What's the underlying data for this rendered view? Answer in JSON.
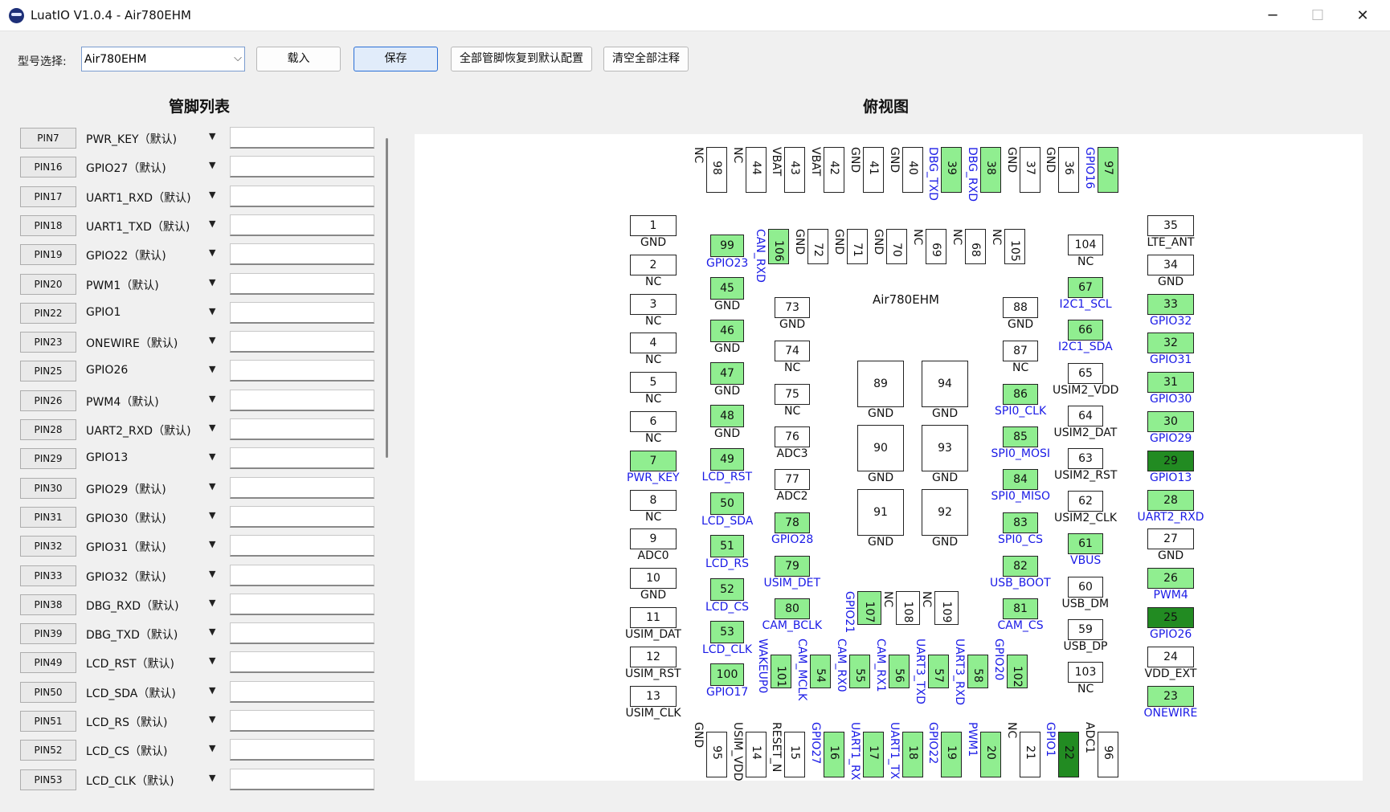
{
  "window": {
    "title": "LuatIO V1.0.4 - Air780EHM",
    "minimize": "─",
    "maximize": "☐",
    "close": "✕"
  },
  "toolbar": {
    "model_label": "型号选择:",
    "model_value": "Air780EHM",
    "load": "载入",
    "save": "保存",
    "restore": "全部管脚恢复到默认配置",
    "clear": "清空全部注释"
  },
  "pin_list": {
    "heading": "管脚列表",
    "items": [
      {
        "pin": "PIN7",
        "func": "PWR_KEY（默认)"
      },
      {
        "pin": "PIN16",
        "func": "GPIO27（默认)"
      },
      {
        "pin": "PIN17",
        "func": "UART1_RXD（默认)"
      },
      {
        "pin": "PIN18",
        "func": "UART1_TXD（默认)"
      },
      {
        "pin": "PIN19",
        "func": "GPIO22（默认)"
      },
      {
        "pin": "PIN20",
        "func": "PWM1（默认)"
      },
      {
        "pin": "PIN22",
        "func": "GPIO1"
      },
      {
        "pin": "PIN23",
        "func": "ONEWIRE（默认)"
      },
      {
        "pin": "PIN25",
        "func": "GPIO26"
      },
      {
        "pin": "PIN26",
        "func": "PWM4（默认)"
      },
      {
        "pin": "PIN28",
        "func": "UART2_RXD（默认)"
      },
      {
        "pin": "PIN29",
        "func": "GPIO13"
      },
      {
        "pin": "PIN30",
        "func": "GPIO29（默认)"
      },
      {
        "pin": "PIN31",
        "func": "GPIO30（默认)"
      },
      {
        "pin": "PIN32",
        "func": "GPIO31（默认)"
      },
      {
        "pin": "PIN33",
        "func": "GPIO32（默认)"
      },
      {
        "pin": "PIN38",
        "func": "DBG_RXD（默认)"
      },
      {
        "pin": "PIN39",
        "func": "DBG_TXD（默认)"
      },
      {
        "pin": "PIN49",
        "func": "LCD_RST（默认)"
      },
      {
        "pin": "PIN50",
        "func": "LCD_SDA（默认)"
      },
      {
        "pin": "PIN51",
        "func": "LCD_RS（默认)"
      },
      {
        "pin": "PIN52",
        "func": "LCD_CS（默认)"
      },
      {
        "pin": "PIN53",
        "func": "LCD_CLK（默认)"
      }
    ]
  },
  "top_view": {
    "heading": "俯视图",
    "chip_name": "Air780EHM",
    "top_pins": [
      {
        "num": "98",
        "label": "NC",
        "state": "n"
      },
      {
        "num": "44",
        "label": "NC",
        "state": "n"
      },
      {
        "num": "43",
        "label": "VBAT",
        "state": "n"
      },
      {
        "num": "42",
        "label": "VBAT",
        "state": "n"
      },
      {
        "num": "41",
        "label": "GND",
        "state": "n"
      },
      {
        "num": "40",
        "label": "GND",
        "state": "n"
      },
      {
        "num": "39",
        "label": "DBG_TXD",
        "state": "g"
      },
      {
        "num": "38",
        "label": "DBG_RXD",
        "state": "g"
      },
      {
        "num": "37",
        "label": "GND",
        "state": "n"
      },
      {
        "num": "36",
        "label": "GND",
        "state": "n"
      },
      {
        "num": "97",
        "label": "GPIO16",
        "state": "g"
      }
    ],
    "left_pins": [
      {
        "num": "1",
        "label": "GND",
        "state": "n"
      },
      {
        "num": "2",
        "label": "NC",
        "state": "n"
      },
      {
        "num": "3",
        "label": "NC",
        "state": "n"
      },
      {
        "num": "4",
        "label": "NC",
        "state": "n"
      },
      {
        "num": "5",
        "label": "NC",
        "state": "n"
      },
      {
        "num": "6",
        "label": "NC",
        "state": "n"
      },
      {
        "num": "7",
        "label": "PWR_KEY",
        "state": "g"
      },
      {
        "num": "8",
        "label": "NC",
        "state": "n"
      },
      {
        "num": "9",
        "label": "ADC0",
        "state": "n"
      },
      {
        "num": "10",
        "label": "GND",
        "state": "n"
      },
      {
        "num": "11",
        "label": "USIM_DAT",
        "state": "n"
      },
      {
        "num": "12",
        "label": "USIM_RST",
        "state": "n"
      },
      {
        "num": "13",
        "label": "USIM_CLK",
        "state": "n"
      }
    ],
    "left_inner": [
      {
        "num": "99",
        "label": "GPIO23",
        "state": "g"
      },
      {
        "num": "45",
        "label": "GND",
        "state": "n"
      },
      {
        "num": "46",
        "label": "GND",
        "state": "n"
      },
      {
        "num": "47",
        "label": "GND",
        "state": "n"
      },
      {
        "num": "48",
        "label": "GND",
        "state": "n"
      },
      {
        "num": "49",
        "label": "LCD_RST",
        "state": "g"
      },
      {
        "num": "50",
        "label": "LCD_SDA",
        "state": "g"
      },
      {
        "num": "51",
        "label": "LCD_RS",
        "state": "g"
      },
      {
        "num": "52",
        "label": "LCD_CS",
        "state": "g"
      },
      {
        "num": "53",
        "label": "LCD_CLK",
        "state": "g"
      },
      {
        "num": "100",
        "label": "GPIO17",
        "state": "g"
      }
    ],
    "second_top": [
      {
        "num": "106",
        "label": "CAN_RXD",
        "state": "g"
      },
      {
        "num": "72",
        "label": "GND",
        "state": "n"
      },
      {
        "num": "71",
        "label": "GND",
        "state": "n"
      },
      {
        "num": "70",
        "label": "GND",
        "state": "n"
      },
      {
        "num": "69",
        "label": "NC",
        "state": "n"
      },
      {
        "num": "68",
        "label": "NC",
        "state": "n"
      },
      {
        "num": "105",
        "label": "NC",
        "state": "n"
      }
    ],
    "inner_left": [
      {
        "num": "73",
        "label": "GND",
        "state": "n"
      },
      {
        "num": "74",
        "label": "NC",
        "state": "n"
      },
      {
        "num": "75",
        "label": "NC",
        "state": "n"
      },
      {
        "num": "76",
        "label": "ADC3",
        "state": "n"
      },
      {
        "num": "77",
        "label": "ADC2",
        "state": "n"
      },
      {
        "num": "78",
        "label": "GPIO28",
        "state": "g"
      },
      {
        "num": "79",
        "label": "USIM_DET",
        "state": "g"
      },
      {
        "num": "80",
        "label": "CAM_BCLK",
        "state": "g"
      }
    ],
    "center_pads": [
      {
        "num": "89",
        "label": "GND"
      },
      {
        "num": "94",
        "label": "GND"
      },
      {
        "num": "90",
        "label": "GND"
      },
      {
        "num": "93",
        "label": "GND"
      },
      {
        "num": "91",
        "label": "GND"
      },
      {
        "num": "92",
        "label": "GND"
      }
    ],
    "inner_right": [
      {
        "num": "88",
        "label": "GND",
        "state": "n"
      },
      {
        "num": "87",
        "label": "NC",
        "state": "n"
      },
      {
        "num": "86",
        "label": "SPI0_CLK",
        "state": "g"
      },
      {
        "num": "85",
        "label": "SPI0_MOSI",
        "state": "g"
      },
      {
        "num": "84",
        "label": "SPI0_MISO",
        "state": "g"
      },
      {
        "num": "83",
        "label": "SPI0_CS",
        "state": "g"
      },
      {
        "num": "82",
        "label": "USB_BOOT",
        "state": "g"
      },
      {
        "num": "81",
        "label": "CAM_CS",
        "state": "g"
      }
    ],
    "right_inner": [
      {
        "num": "104",
        "label": "NC",
        "state": "n"
      },
      {
        "num": "67",
        "label": "I2C1_SCL",
        "state": "g"
      },
      {
        "num": "66",
        "label": "I2C1_SDA",
        "state": "g"
      },
      {
        "num": "65",
        "label": "USIM2_VDD",
        "state": "n"
      },
      {
        "num": "64",
        "label": "USIM2_DAT",
        "state": "n"
      },
      {
        "num": "63",
        "label": "USIM2_RST",
        "state": "n"
      },
      {
        "num": "62",
        "label": "USIM2_CLK",
        "state": "n"
      },
      {
        "num": "61",
        "label": "VBUS",
        "state": "g"
      },
      {
        "num": "60",
        "label": "USB_DM",
        "state": "n"
      },
      {
        "num": "59",
        "label": "USB_DP",
        "state": "n"
      },
      {
        "num": "103",
        "label": "NC",
        "state": "n"
      }
    ],
    "right_pins": [
      {
        "num": "35",
        "label": "LTE_ANT",
        "state": "n"
      },
      {
        "num": "34",
        "label": "GND",
        "state": "n"
      },
      {
        "num": "33",
        "label": "GPIO32",
        "state": "g"
      },
      {
        "num": "32",
        "label": "GPIO31",
        "state": "g"
      },
      {
        "num": "31",
        "label": "GPIO30",
        "state": "g"
      },
      {
        "num": "30",
        "label": "GPIO29",
        "state": "g"
      },
      {
        "num": "29",
        "label": "GPIO13",
        "state": "d"
      },
      {
        "num": "28",
        "label": "UART2_RXD",
        "state": "g"
      },
      {
        "num": "27",
        "label": "GND",
        "state": "n"
      },
      {
        "num": "26",
        "label": "PWM4",
        "state": "g"
      },
      {
        "num": "25",
        "label": "GPIO26",
        "state": "d"
      },
      {
        "num": "24",
        "label": "VDD_EXT",
        "state": "n"
      },
      {
        "num": "23",
        "label": "ONEWIRE",
        "state": "g"
      }
    ],
    "inner_bottom_a": [
      {
        "num": "107",
        "label": "GPIO21",
        "state": "g"
      },
      {
        "num": "108",
        "label": "NC",
        "state": "n"
      },
      {
        "num": "109",
        "label": "NC",
        "state": "n"
      }
    ],
    "second_bottom": [
      {
        "num": "101",
        "label": "WAKEUP0",
        "state": "g"
      },
      {
        "num": "54",
        "label": "CAM_MCLK",
        "state": "g"
      },
      {
        "num": "55",
        "label": "CAM_RX0",
        "state": "g"
      },
      {
        "num": "56",
        "label": "CAM_RX1",
        "state": "g"
      },
      {
        "num": "57",
        "label": "UART3_TXD",
        "state": "g"
      },
      {
        "num": "58",
        "label": "UART3_RXD",
        "state": "g"
      },
      {
        "num": "102",
        "label": "GPIO20",
        "state": "g"
      }
    ],
    "bottom_pins": [
      {
        "num": "95",
        "label": "GND",
        "state": "n"
      },
      {
        "num": "14",
        "label": "USIM_VDD",
        "state": "n"
      },
      {
        "num": "15",
        "label": "RESET_N",
        "state": "n"
      },
      {
        "num": "16",
        "label": "GPIO27",
        "state": "g"
      },
      {
        "num": "17",
        "label": "UART1_RX",
        "state": "g"
      },
      {
        "num": "18",
        "label": "UART1_TX",
        "state": "g"
      },
      {
        "num": "19",
        "label": "GPIO22",
        "state": "g"
      },
      {
        "num": "20",
        "label": "PWM1",
        "state": "g"
      },
      {
        "num": "21",
        "label": "NC",
        "state": "n"
      },
      {
        "num": "22",
        "label": "GPIO1",
        "state": "d"
      },
      {
        "num": "96",
        "label": "ADC1",
        "state": "n"
      }
    ]
  }
}
